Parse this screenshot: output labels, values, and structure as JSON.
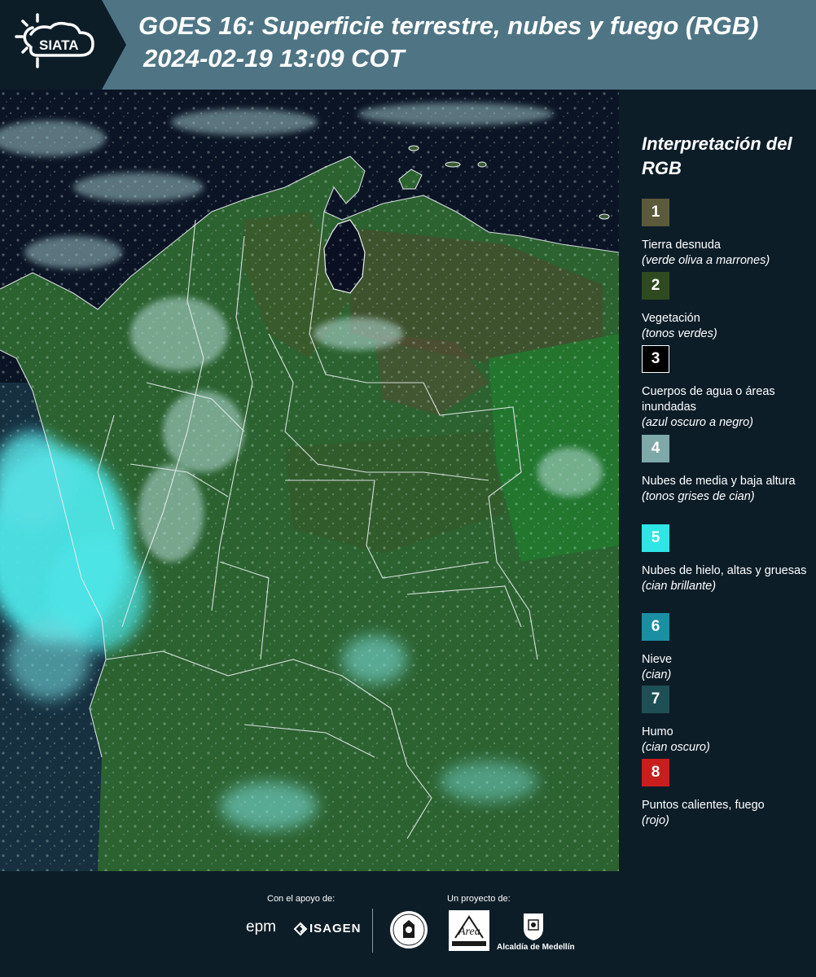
{
  "header": {
    "logo_text": "SIATA",
    "title_line1": "GOES 16: Superficie terrestre, nubes y fuego (RGB)",
    "title_line2": "2024-02-19 13:09 COT"
  },
  "legend": {
    "title": "Interpretación del RGB",
    "items": [
      {
        "number": "1",
        "label": "Tierra desnuda",
        "desc": "(verde oliva a marrones)",
        "color": "#5b5a3b"
      },
      {
        "number": "2",
        "label": "Vegetación",
        "desc": "(tonos verdes)",
        "color": "#2f4a1f"
      },
      {
        "number": "3",
        "label": "Cuerpos de agua o áreas inundadas",
        "desc": "(azul oscuro a negro)",
        "color": "#000000"
      },
      {
        "number": "4",
        "label": "Nubes de media y baja altura",
        "desc": "(tonos grises de cian)",
        "color": "#7fa8a9"
      },
      {
        "number": "5",
        "label": "Nubes de hielo, altas y gruesas",
        "desc": "(cian brillante)",
        "color": "#2fe5e5"
      },
      {
        "number": "6",
        "label": "Nieve",
        "desc": "(cian)",
        "color": "#1c8ea2"
      },
      {
        "number": "7",
        "label": "Humo",
        "desc": "(cian oscuro)",
        "color": "#1e4f55"
      },
      {
        "number": "8",
        "label": "Puntos calientes, fuego",
        "desc": "(rojo)",
        "color": "#c81e1e"
      }
    ]
  },
  "footer": {
    "support_label": "Con el apoyo de:",
    "project_label": "Un proyecto de:",
    "sponsor_epm": "epm",
    "sponsor_isagen": "ISAGEN",
    "area_metro_text": "Área",
    "alcaldia": "Alcaldía de Medellín"
  },
  "colors": {
    "header_bg": "#4f7585",
    "logo_panel_bg": "#0d1d28",
    "page_bg": "#0d1d28",
    "ocean": "#0b1424",
    "vegetation": "#2f6a32",
    "borders": "#e8eef0",
    "ice_cloud": "#4ee6e8"
  },
  "icons": [
    "siata-logo",
    "sun-cloud-icon",
    "isagen-logo",
    "university-seal",
    "area-metropolitana-logo",
    "medellin-coat-of-arms"
  ]
}
